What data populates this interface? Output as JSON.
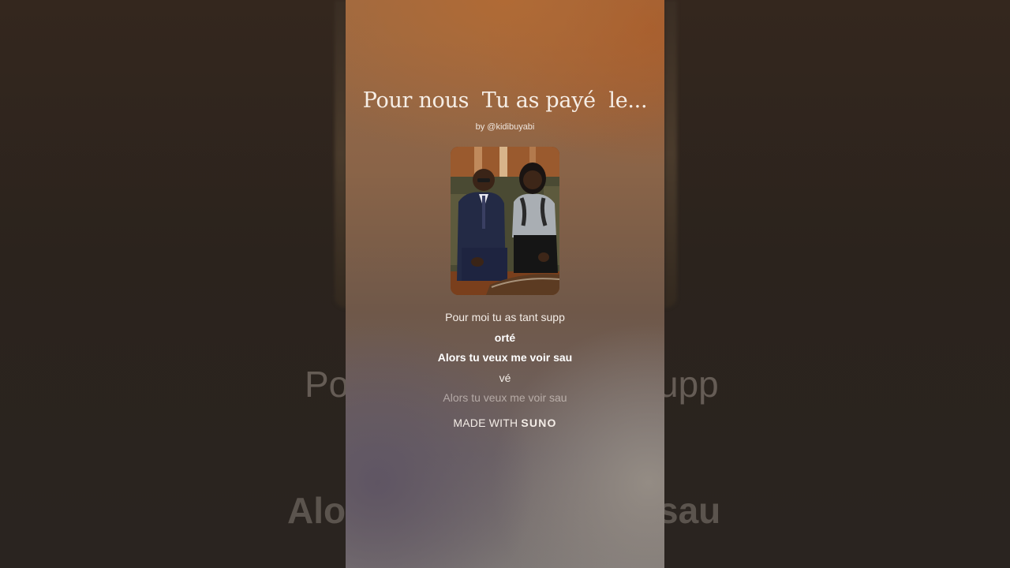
{
  "song": {
    "title": "Pour nous  Tu as payé  le...",
    "byline": "by @kidibuyabi"
  },
  "lyrics": [
    {
      "text": "Pour moi tu as tant supp",
      "style": "normal"
    },
    {
      "text": "orté",
      "style": "bold"
    },
    {
      "text": "Alors tu veux me voir sau",
      "style": "bold"
    },
    {
      "text": "vé",
      "style": "normal"
    },
    {
      "text": "Alors tu veux me voir sau",
      "style": "faded"
    }
  ],
  "brand": {
    "prefix": "MADE WITH",
    "name": "SUNO"
  },
  "background_echo": {
    "line1_left": "Po",
    "line1_right": "upp",
    "line2_left": "Alo",
    "line2_right": "sau"
  },
  "icons": {
    "cover": "cover-art-photo"
  },
  "colors": {
    "accent_top": "#b06a35",
    "text": "#f4ede7",
    "page_bg": "#2a211b"
  }
}
